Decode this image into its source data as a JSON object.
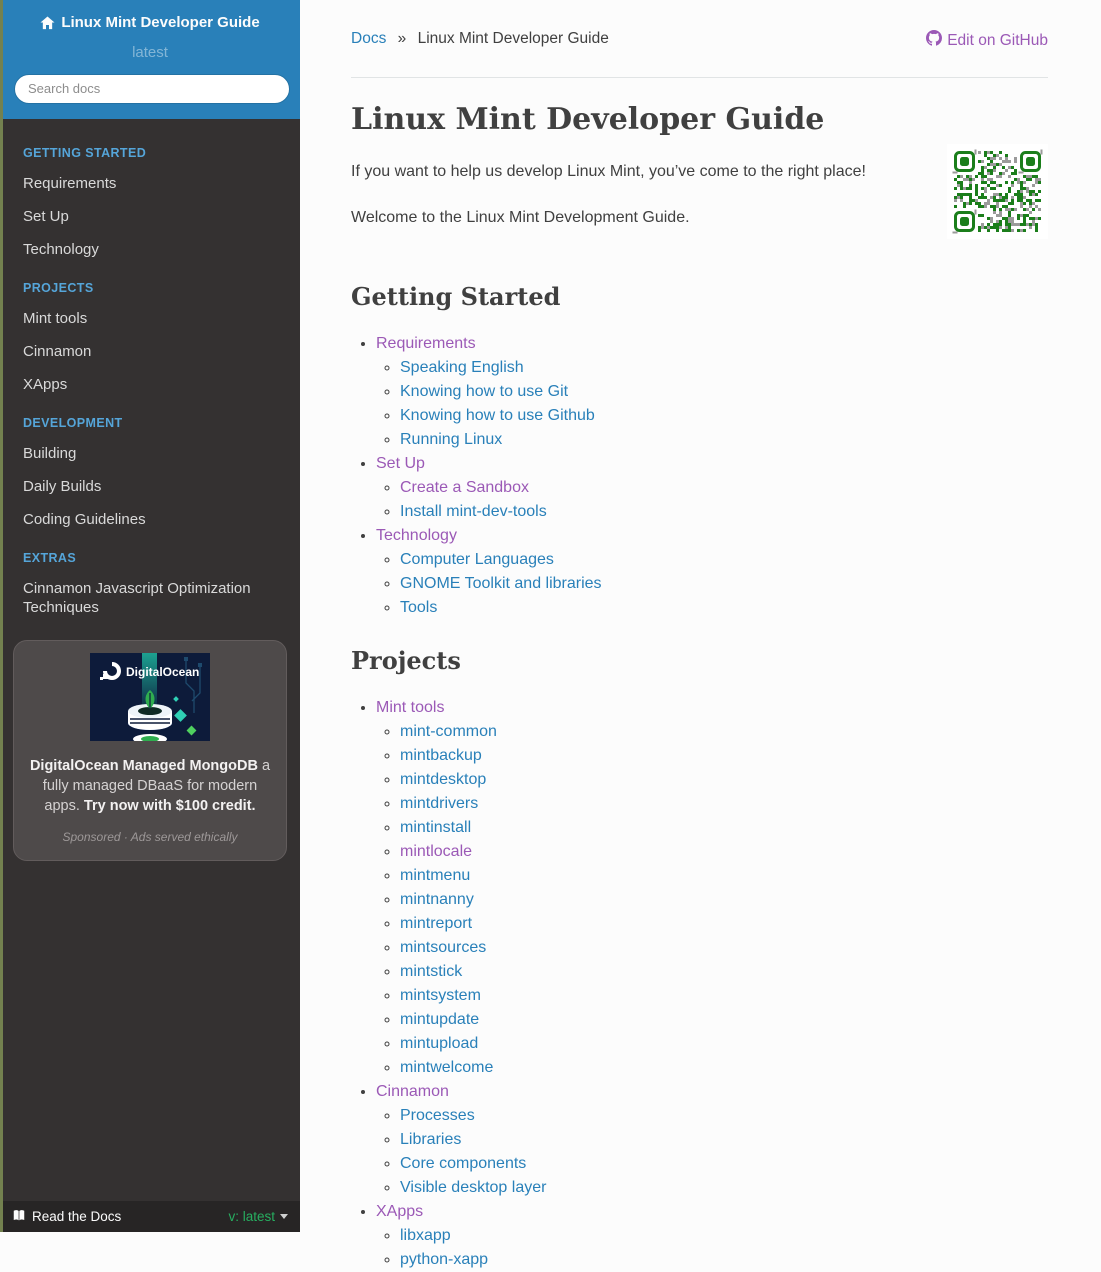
{
  "colors": {
    "header_blue": "#2980B9",
    "link_blue": "#2980B9",
    "visited_purple": "#9B59B6",
    "caption_blue": "#55a5d9",
    "version_green": "#27AE60",
    "qr_green": "#1b7e1b",
    "sidebar_bg": "#343131"
  },
  "sidebar": {
    "title": "Linux Mint Developer Guide",
    "version": "latest",
    "search_placeholder": "Search docs",
    "groups": [
      {
        "caption": "GETTING STARTED",
        "items": [
          "Requirements",
          "Set Up",
          "Technology"
        ]
      },
      {
        "caption": "PROJECTS",
        "items": [
          "Mint tools",
          "Cinnamon",
          "XApps"
        ]
      },
      {
        "caption": "DEVELOPMENT",
        "items": [
          "Building",
          "Daily Builds",
          "Coding Guidelines"
        ]
      },
      {
        "caption": "EXTRAS",
        "items": [
          "Cinnamon Javascript Optimization Techniques"
        ]
      }
    ],
    "ad": {
      "image_brand": "DigitalOcean",
      "headline_bold": "DigitalOcean Managed MongoDB",
      "headline_rest": " a fully managed DBaaS for modern apps. ",
      "cta": "Try now with $100 credit.",
      "sponsored": "Sponsored · Ads served ethically"
    },
    "footer": {
      "brand": "Read the Docs",
      "version_label": "v: latest"
    }
  },
  "breadcrumb": {
    "root": "Docs",
    "separator": "»",
    "current": "Linux Mint Developer Guide"
  },
  "edit_on_github": "Edit on GitHub",
  "main": {
    "title": "Linux Mint Developer Guide",
    "paragraphs": [
      "If you want to help us develop Linux Mint, you’ve come to the right place!",
      "Welcome to the Linux Mint Development Guide."
    ],
    "sections": [
      {
        "heading": "Getting Started",
        "toc": [
          {
            "label": "Requirements",
            "visited": true,
            "children": [
              {
                "label": "Speaking English",
                "visited": false
              },
              {
                "label": "Knowing how to use Git",
                "visited": false
              },
              {
                "label": "Knowing how to use Github",
                "visited": false
              },
              {
                "label": "Running Linux",
                "visited": false
              }
            ]
          },
          {
            "label": "Set Up",
            "visited": true,
            "children": [
              {
                "label": "Create a Sandbox",
                "visited": true
              },
              {
                "label": "Install mint-dev-tools",
                "visited": false
              }
            ]
          },
          {
            "label": "Technology",
            "visited": true,
            "children": [
              {
                "label": "Computer Languages",
                "visited": false
              },
              {
                "label": "GNOME Toolkit and libraries",
                "visited": false
              },
              {
                "label": "Tools",
                "visited": false
              }
            ]
          }
        ]
      },
      {
        "heading": "Projects",
        "toc": [
          {
            "label": "Mint tools",
            "visited": true,
            "children": [
              {
                "label": "mint-common",
                "visited": false
              },
              {
                "label": "mintbackup",
                "visited": false
              },
              {
                "label": "mintdesktop",
                "visited": false
              },
              {
                "label": "mintdrivers",
                "visited": false
              },
              {
                "label": "mintinstall",
                "visited": false
              },
              {
                "label": "mintlocale",
                "visited": true
              },
              {
                "label": "mintmenu",
                "visited": false
              },
              {
                "label": "mintnanny",
                "visited": false
              },
              {
                "label": "mintreport",
                "visited": false
              },
              {
                "label": "mintsources",
                "visited": false
              },
              {
                "label": "mintstick",
                "visited": false
              },
              {
                "label": "mintsystem",
                "visited": false
              },
              {
                "label": "mintupdate",
                "visited": false
              },
              {
                "label": "mintupload",
                "visited": false
              },
              {
                "label": "mintwelcome",
                "visited": false
              }
            ]
          },
          {
            "label": "Cinnamon",
            "visited": true,
            "children": [
              {
                "label": "Processes",
                "visited": false
              },
              {
                "label": "Libraries",
                "visited": false
              },
              {
                "label": "Core components",
                "visited": false
              },
              {
                "label": "Visible desktop layer",
                "visited": false
              }
            ]
          },
          {
            "label": "XApps",
            "visited": true,
            "children": [
              {
                "label": "libxapp",
                "visited": false
              },
              {
                "label": "python-xapp",
                "visited": false
              }
            ]
          }
        ]
      }
    ]
  }
}
